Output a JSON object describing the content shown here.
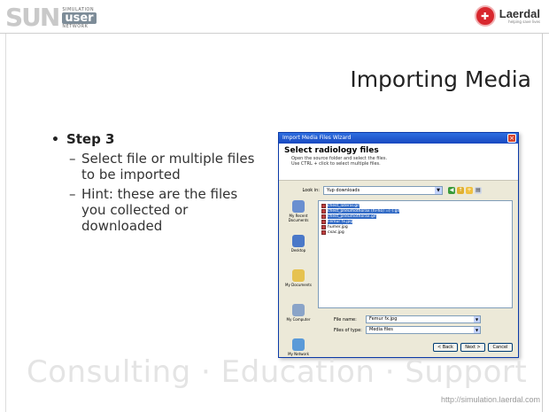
{
  "header": {
    "sun_letters": "SUN",
    "sun_simulation": "SIMULATION",
    "sun_user": "user",
    "sun_network": "NETWORK",
    "laerdal_name": "Laerdal",
    "laerdal_tagline": "helping save lives"
  },
  "slide": {
    "title": "Importing Media",
    "step": "Step 3",
    "points": [
      "Select file or multiple files to be imported",
      "Hint:  these are the files you collected or downloaded"
    ]
  },
  "dialog": {
    "title": "Import Media Files Wizard",
    "heading": "Select radiology files",
    "instructions": [
      "Open the source folder and select the files.",
      "Use CTRL + click to select multiple files."
    ],
    "look_in_label": "Look in:",
    "look_in_value": "Yup downloads",
    "places": [
      {
        "icon": "recent-documents-icon",
        "label": "My Recent Documents"
      },
      {
        "icon": "desktop-icon",
        "label": "Desktop"
      },
      {
        "icon": "my-documents-icon",
        "label": "My Documents"
      },
      {
        "icon": "my-computer-icon",
        "label": "My Computer"
      },
      {
        "icon": "my-network-icon",
        "label": "My Network"
      }
    ],
    "files": [
      "chest_lateral.gif",
      "chest_pneumothorax (hi-ho) =(-).gif",
      "chest_pneumothorax.gif",
      "Femur fx.jpg",
      "humer.jpg",
      "cxac.jpg"
    ],
    "file_name_label": "File name:",
    "file_name_value": "Femur fx.jpg",
    "file_type_label": "Files of type:",
    "file_type_value": "Media files",
    "buttons": {
      "back": "< Back",
      "next": "Next >",
      "cancel": "Cancel"
    },
    "colors": {
      "titlebar": "#1848c0",
      "selection": "#316ac5",
      "body": "#ece9d8"
    }
  },
  "footer": {
    "watermark": "Consulting  ·  Education  ·  Support",
    "url": "http://simulation.laerdal.com"
  }
}
